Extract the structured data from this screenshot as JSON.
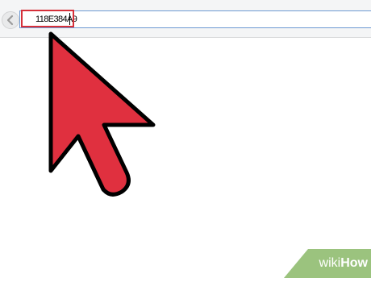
{
  "browser": {
    "address_bar": {
      "value": "118E384A9"
    }
  },
  "annotation": {
    "highlight_color": "#d6303a",
    "arrow_color": "#e0303f",
    "arrow_icon": "red-pointer-arrow-icon"
  },
  "watermark": {
    "brand_part1": "wiki",
    "brand_part2": "How",
    "badge_color": "#9bc37e"
  }
}
